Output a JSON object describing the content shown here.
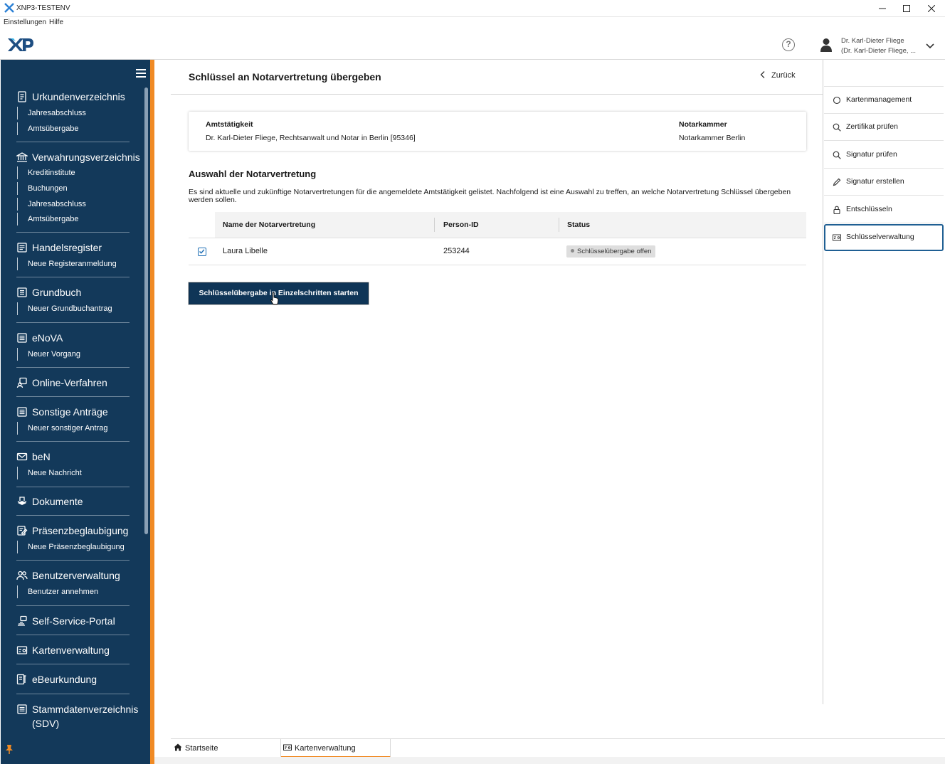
{
  "window": {
    "title": "XNP3-TESTENV",
    "minimize": "—",
    "maximize": "☐",
    "close": "✕"
  },
  "menu": {
    "items": [
      "Einstellungen",
      "Hilfe"
    ]
  },
  "header": {
    "help_icon": "?",
    "user_name": "Dr. Karl-Dieter Fliege",
    "user_sub": "(Dr. Karl-Dieter Fliege, ..."
  },
  "sidebar": {
    "sections": [
      {
        "label": "Urkundenverzeichnis",
        "icon": "document-icon",
        "subs": [
          "Jahresabschluss",
          "Amtsübergabe"
        ]
      },
      {
        "label": "Verwahrungsverzeichnis",
        "icon": "bank-icon",
        "subs": [
          "Kreditinstitute",
          "Buchungen",
          "Jahresabschluss",
          "Amtsübergabe"
        ]
      },
      {
        "label": "Handelsregister",
        "icon": "register-icon",
        "subs": [
          "Neue Registeranmeldung"
        ]
      },
      {
        "label": "Grundbuch",
        "icon": "book-icon",
        "subs": [
          "Neuer Grundbuchantrag"
        ]
      },
      {
        "label": "eNoVA",
        "icon": "form-icon",
        "subs": [
          "Neuer Vorgang"
        ]
      },
      {
        "label": "Online-Verfahren",
        "icon": "online-icon",
        "subs": []
      },
      {
        "label": "Sonstige Anträge",
        "icon": "list-icon",
        "subs": [
          "Neuer sonstiger Antrag"
        ]
      },
      {
        "label": "beN",
        "icon": "mail-icon",
        "subs": [
          "Neue Nachricht"
        ]
      },
      {
        "label": "Dokumente",
        "icon": "documents-icon",
        "subs": []
      },
      {
        "label": "Präsenzbeglaubigung",
        "icon": "certify-icon",
        "subs": [
          "Neue Präsenzbeglaubigung"
        ]
      },
      {
        "label": "Benutzerverwaltung",
        "icon": "users-icon",
        "subs": [
          "Benutzer annehmen"
        ]
      },
      {
        "label": "Self-Service-Portal",
        "icon": "portal-icon",
        "subs": []
      },
      {
        "label": "Kartenverwaltung",
        "icon": "card-icon",
        "subs": []
      },
      {
        "label": "eBeurkundung",
        "icon": "ebeurkundung-icon",
        "subs": []
      },
      {
        "label": "Stammdatenverzeichnis",
        "label2": "(SDV)",
        "icon": "masterdata-icon",
        "subs": []
      }
    ]
  },
  "main": {
    "title": "Schlüssel an Notarvertretung übergeben",
    "back_label": "Zurück",
    "info": {
      "amt_key": "Amtstätigkeit",
      "amt_value": "Dr. Karl-Dieter Fliege, Rechtsanwalt und Notar in Berlin [95346]",
      "kammer_key": "Notarkammer",
      "kammer_value": "Notarkammer Berlin"
    },
    "section_title": "Auswahl der Notarvertretung",
    "section_desc": "Es sind aktuelle und zukünftige Notarvertretungen für die angemeldete Amtstätigkeit gelistet. Nachfolgend ist eine Auswahl zu treffen, an welche Notarvertretung Schlüssel übergeben werden sollen.",
    "table": {
      "headers": [
        "Name der Notarvertretung",
        "Person-ID",
        "Status"
      ],
      "rows": [
        {
          "checked": true,
          "name": "Laura Libelle",
          "person_id": "253244",
          "status": "Schlüsselübergabe offen"
        }
      ]
    },
    "primary_button": "Schlüsselübergabe in Einzelschritten starten"
  },
  "right_panel": {
    "items": [
      {
        "label": "Kartenmanagement",
        "icon": "circle-icon",
        "active": false
      },
      {
        "label": "Zertifikat prüfen",
        "icon": "search-icon",
        "active": false
      },
      {
        "label": "Signatur prüfen",
        "icon": "search-icon",
        "active": false
      },
      {
        "label": "Signatur erstellen",
        "icon": "pen-icon",
        "active": false
      },
      {
        "label": "Entschlüsseln",
        "icon": "lock-icon",
        "active": false
      },
      {
        "label": "Schlüsselverwaltung",
        "icon": "card-icon",
        "active": true
      }
    ]
  },
  "bottom_tabs": [
    {
      "label": "Startseite",
      "icon": "home-icon",
      "active": false
    },
    {
      "label": "Kartenverwaltung",
      "icon": "card-icon",
      "active": true
    }
  ],
  "colors": {
    "sidebar": "#13395a",
    "accent": "#f08a24",
    "primary": "#0f3557"
  }
}
